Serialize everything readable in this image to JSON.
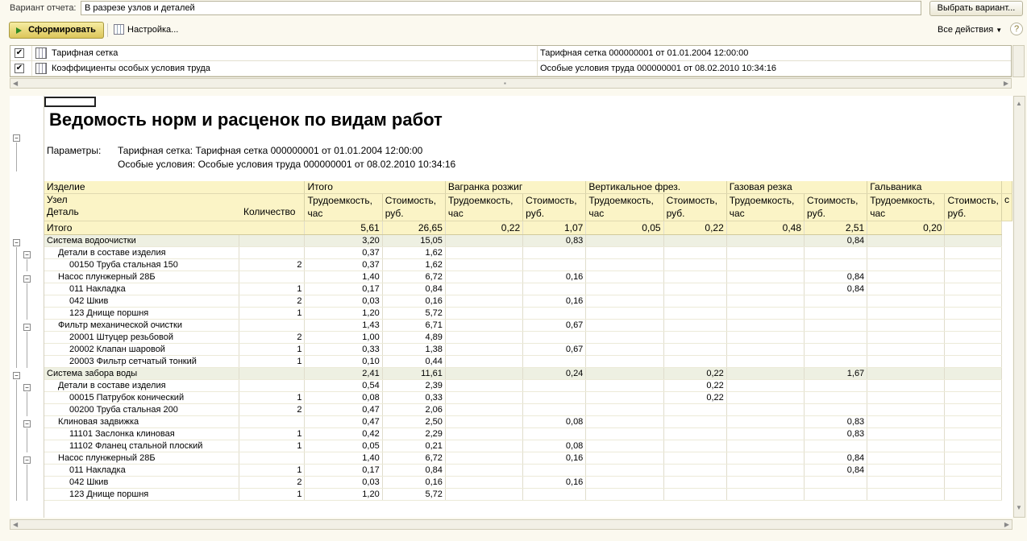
{
  "toolbar": {
    "variant_label": "Вариант отчета:",
    "variant_value": "В разрезе узлов и деталей",
    "choose_variant": "Выбрать вариант...",
    "generate": "Сформировать",
    "settings": "Настройка...",
    "all_actions": "Все действия",
    "help": "?"
  },
  "params": [
    {
      "checked": true,
      "name": "Тарифная сетка",
      "value": "Тарифная сетка 000000001 от 01.01.2004 12:00:00"
    },
    {
      "checked": true,
      "name": "Коэффициенты особых условия труда",
      "value": "Особые условия труда 000000001 от 08.02.2010 10:34:16"
    }
  ],
  "report": {
    "title": "Ведомость норм и расценок по видам работ",
    "params_label": "Параметры:",
    "param_lines": [
      "Тарифная сетка: Тарифная сетка 000000001 от 01.01.2004 12:00:00",
      "Особые условия: Особые условия труда 000000001 от 08.02.2010 10:34:16"
    ],
    "header": {
      "h1": "Изделие",
      "h2": "Узел",
      "h3": "Деталь",
      "qty": "Количество",
      "groups": [
        "Итого",
        "Вагранка розжиг",
        "Вертикальное фрез.",
        "Газовая резка",
        "Гальваника"
      ],
      "sub1": "Трудоемкость, час",
      "sub2": "Стоимость, руб."
    },
    "total": {
      "label": "Итого",
      "v": [
        "5,61",
        "26,65",
        "0,22",
        "1,07",
        "0,05",
        "0,22",
        "0,48",
        "2,51",
        "0,20"
      ]
    },
    "rows": [
      {
        "lvl": 0,
        "name": "Система водоочистки",
        "qty": "",
        "v": [
          "3,20",
          "15,05",
          "",
          "0,83",
          "",
          "",
          "",
          "0,84",
          ""
        ]
      },
      {
        "lvl": 1,
        "name": "Детали в составе изделия",
        "qty": "",
        "v": [
          "0,37",
          "1,62",
          "",
          "",
          "",
          "",
          "",
          "",
          ""
        ]
      },
      {
        "lvl": 2,
        "name": "00150 Труба стальная 150",
        "qty": "2",
        "v": [
          "0,37",
          "1,62",
          "",
          "",
          "",
          "",
          "",
          "",
          ""
        ]
      },
      {
        "lvl": 1,
        "name": "Насос плунжерный 28Б",
        "qty": "",
        "v": [
          "1,40",
          "6,72",
          "",
          "0,16",
          "",
          "",
          "",
          "0,84",
          ""
        ]
      },
      {
        "lvl": 2,
        "name": "011 Накладка",
        "qty": "1",
        "v": [
          "0,17",
          "0,84",
          "",
          "",
          "",
          "",
          "",
          "0,84",
          ""
        ]
      },
      {
        "lvl": 2,
        "name": "042 Шкив",
        "qty": "2",
        "v": [
          "0,03",
          "0,16",
          "",
          "0,16",
          "",
          "",
          "",
          "",
          ""
        ]
      },
      {
        "lvl": 2,
        "name": "123 Днище поршня",
        "qty": "1",
        "v": [
          "1,20",
          "5,72",
          "",
          "",
          "",
          "",
          "",
          "",
          ""
        ]
      },
      {
        "lvl": 1,
        "name": "Фильтр механической очистки",
        "qty": "",
        "v": [
          "1,43",
          "6,71",
          "",
          "0,67",
          "",
          "",
          "",
          "",
          ""
        ]
      },
      {
        "lvl": 2,
        "name": "20001 Штуцер резьбовой",
        "qty": "2",
        "v": [
          "1,00",
          "4,89",
          "",
          "",
          "",
          "",
          "",
          "",
          ""
        ]
      },
      {
        "lvl": 2,
        "name": "20002 Клапан шаровой",
        "qty": "1",
        "v": [
          "0,33",
          "1,38",
          "",
          "0,67",
          "",
          "",
          "",
          "",
          ""
        ]
      },
      {
        "lvl": 2,
        "name": "20003 Фильтр сетчатый тонкий",
        "qty": "1",
        "v": [
          "0,10",
          "0,44",
          "",
          "",
          "",
          "",
          "",
          "",
          ""
        ]
      },
      {
        "lvl": 0,
        "name": "Система забора воды",
        "qty": "",
        "v": [
          "2,41",
          "11,61",
          "",
          "0,24",
          "",
          "0,22",
          "",
          "1,67",
          ""
        ]
      },
      {
        "lvl": 1,
        "name": "Детали в составе изделия",
        "qty": "",
        "v": [
          "0,54",
          "2,39",
          "",
          "",
          "",
          "0,22",
          "",
          "",
          ""
        ]
      },
      {
        "lvl": 2,
        "name": "00015 Патрубок конический",
        "qty": "1",
        "v": [
          "0,08",
          "0,33",
          "",
          "",
          "",
          "0,22",
          "",
          "",
          ""
        ]
      },
      {
        "lvl": 2,
        "name": "00200 Труба стальная 200",
        "qty": "2",
        "v": [
          "0,47",
          "2,06",
          "",
          "",
          "",
          "",
          "",
          "",
          ""
        ]
      },
      {
        "lvl": 1,
        "name": "Клиновая задвижка",
        "qty": "",
        "v": [
          "0,47",
          "2,50",
          "",
          "0,08",
          "",
          "",
          "",
          "0,83",
          ""
        ]
      },
      {
        "lvl": 2,
        "name": "11101 Заслонка клиновая",
        "qty": "1",
        "v": [
          "0,42",
          "2,29",
          "",
          "",
          "",
          "",
          "",
          "0,83",
          ""
        ]
      },
      {
        "lvl": 2,
        "name": "11102 Фланец стальной плоский",
        "qty": "1",
        "v": [
          "0,05",
          "0,21",
          "",
          "0,08",
          "",
          "",
          "",
          "",
          ""
        ]
      },
      {
        "lvl": 1,
        "name": "Насос плунжерный 28Б",
        "qty": "",
        "v": [
          "1,40",
          "6,72",
          "",
          "0,16",
          "",
          "",
          "",
          "0,84",
          ""
        ]
      },
      {
        "lvl": 2,
        "name": "011 Накладка",
        "qty": "1",
        "v": [
          "0,17",
          "0,84",
          "",
          "",
          "",
          "",
          "",
          "0,84",
          ""
        ]
      },
      {
        "lvl": 2,
        "name": "042 Шкив",
        "qty": "2",
        "v": [
          "0,03",
          "0,16",
          "",
          "0,16",
          "",
          "",
          "",
          "",
          ""
        ]
      },
      {
        "lvl": 2,
        "name": "123 Днище поршня",
        "qty": "1",
        "v": [
          "1,20",
          "5,72",
          "",
          "",
          "",
          "",
          "",
          "",
          ""
        ]
      }
    ]
  },
  "colors": {
    "header_bg": "#fbf4c6",
    "group_bg": "#eef0e2",
    "generate_btn": "#dcc65a"
  }
}
